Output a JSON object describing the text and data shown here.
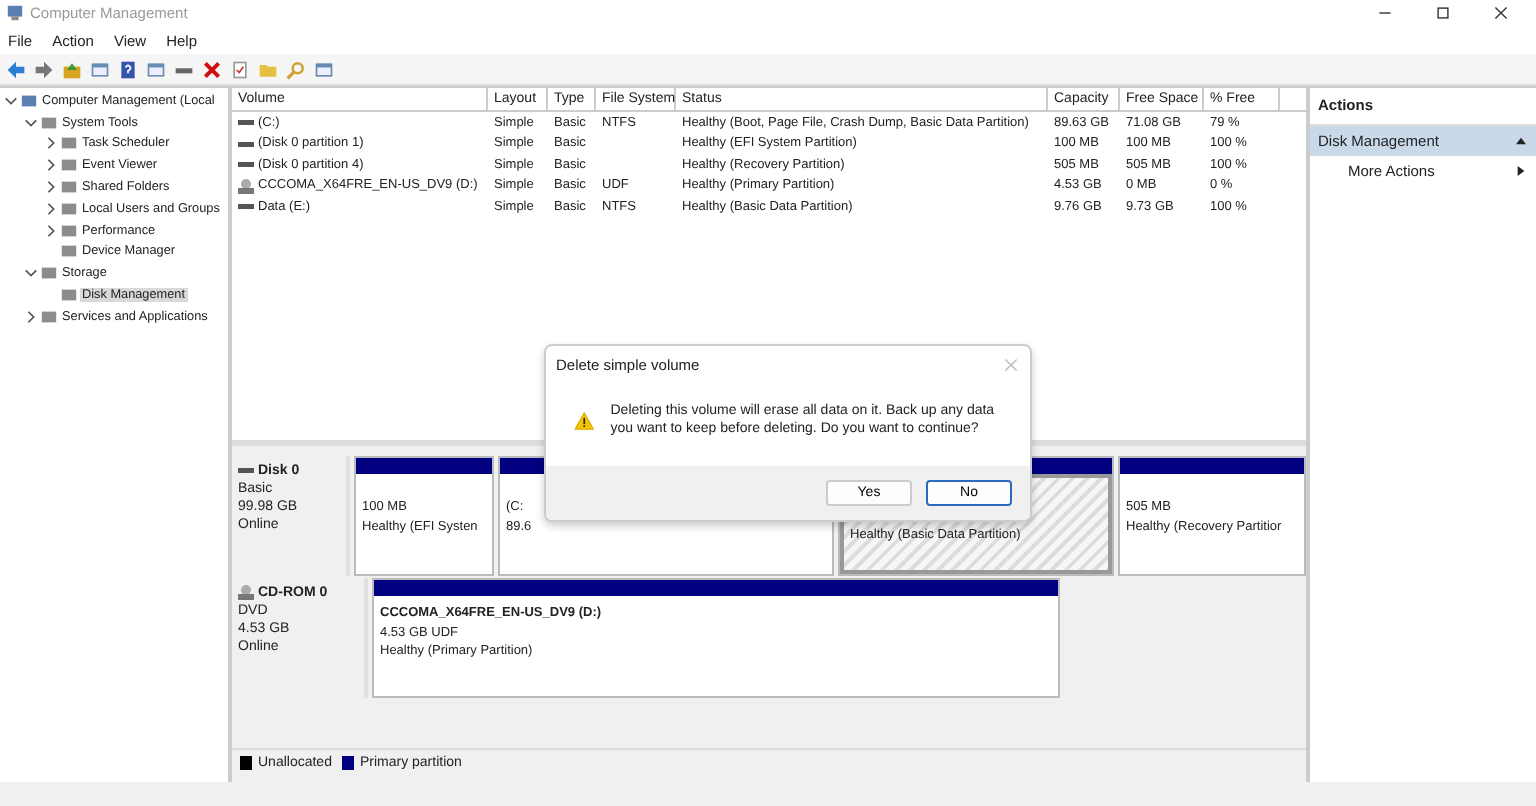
{
  "window": {
    "title": "Computer Management"
  },
  "menu": [
    "File",
    "Action",
    "View",
    "Help"
  ],
  "toolbar": [
    {
      "kind": "back"
    },
    {
      "kind": "forward"
    },
    {
      "kind": "up"
    },
    {
      "kind": "console"
    },
    {
      "kind": "help"
    },
    {
      "kind": "console"
    },
    {
      "kind": "drive"
    },
    {
      "kind": "delete"
    },
    {
      "kind": "properties"
    },
    {
      "kind": "folder"
    },
    {
      "kind": "search"
    },
    {
      "kind": "window"
    }
  ],
  "tree": [
    {
      "label": "Computer Management (Local",
      "expanded": true,
      "selected": false,
      "children": [
        {
          "label": "System Tools",
          "expanded": true,
          "selected": false,
          "children": [
            {
              "label": "Task Scheduler",
              "expanded": false,
              "selected": false
            },
            {
              "label": "Event Viewer",
              "expanded": false,
              "selected": false
            },
            {
              "label": "Shared Folders",
              "expanded": false,
              "selected": false
            },
            {
              "label": "Local Users and Groups",
              "expanded": false,
              "selected": false
            },
            {
              "label": "Performance",
              "expanded": false,
              "selected": false
            },
            {
              "label": "Device Manager",
              "selected": false
            }
          ]
        },
        {
          "label": "Storage",
          "expanded": true,
          "selected": false,
          "children": [
            {
              "label": "Disk Management",
              "selected": true
            }
          ]
        },
        {
          "label": "Services and Applications",
          "expanded": false,
          "selected": false
        }
      ]
    }
  ],
  "table": {
    "columns": [
      "Volume",
      "Layout",
      "Type",
      "File System",
      "Status",
      "Capacity",
      "Free Space",
      "% Free"
    ],
    "rows": [
      {
        "kind": "disk",
        "cells": [
          "(C:)",
          "Simple",
          "Basic",
          "NTFS",
          "Healthy (Boot, Page File, Crash Dump, Basic Data Partition)",
          "89.63 GB",
          "71.08 GB",
          "79 %"
        ]
      },
      {
        "kind": "disk",
        "cells": [
          "(Disk 0 partition 1)",
          "Simple",
          "Basic",
          "",
          "Healthy (EFI System Partition)",
          "100 MB",
          "100 MB",
          "100 %"
        ]
      },
      {
        "kind": "disk",
        "cells": [
          "(Disk 0 partition 4)",
          "Simple",
          "Basic",
          "",
          "Healthy (Recovery Partition)",
          "505 MB",
          "505 MB",
          "100 %"
        ]
      },
      {
        "kind": "cdrom",
        "cells": [
          "CCCOMA_X64FRE_EN-US_DV9 (D:)",
          "Simple",
          "Basic",
          "UDF",
          "Healthy (Primary Partition)",
          "4.53 GB",
          "0 MB",
          "0 %"
        ]
      },
      {
        "kind": "disk",
        "cells": [
          "Data (E:)",
          "Simple",
          "Basic",
          "NTFS",
          "Healthy (Basic Data Partition)",
          "9.76 GB",
          "9.73 GB",
          "100 %"
        ]
      }
    ]
  },
  "disks": [
    {
      "kind": "disk",
      "name": "Disk 0",
      "lines": [
        "Basic",
        "99.98 GB",
        "Online"
      ],
      "partitions": [
        {
          "lines": [
            "100 MB",
            "Healthy (EFI Systen"
          ],
          "selected": false
        },
        {
          "lines": [
            "(C:",
            "89.6"
          ],
          "selected": false
        },
        {
          "lines": [
            "Healthy (Basic Data Partition)"
          ],
          "selected": true
        },
        {
          "lines": [
            "505 MB",
            "Healthy (Recovery Partitior"
          ],
          "selected": false
        }
      ]
    },
    {
      "kind": "cdrom",
      "name": "CD-ROM 0",
      "lines": [
        "DVD",
        "4.53 GB",
        "Online"
      ],
      "partitions": [
        {
          "lines": [
            "CCCOMA_X64FRE_EN-US_DV9  (D:)",
            "4.53 GB UDF",
            "Healthy (Primary Partition)"
          ],
          "selected": false
        }
      ]
    }
  ],
  "legend": [
    {
      "label": "Unallocated",
      "color": "#000000"
    },
    {
      "label": "Primary partition",
      "color": "#000080"
    }
  ],
  "actions": {
    "title": "Actions",
    "section": "Disk Management",
    "items": [
      "More Actions"
    ]
  },
  "dialog": {
    "title": "Delete simple volume",
    "message": "Deleting this volume will erase all data on it. Back up any data you want to keep before deleting. Do you want to continue?",
    "buttons": [
      {
        "label": "Yes",
        "selected": false
      },
      {
        "label": "No",
        "selected": true
      }
    ]
  }
}
